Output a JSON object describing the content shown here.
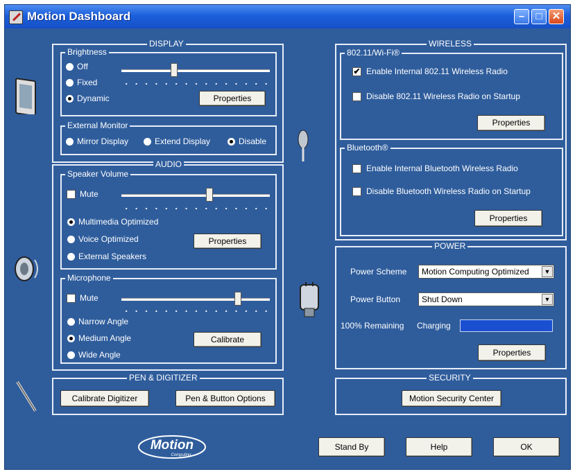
{
  "window": {
    "title": "Motion Dashboard",
    "minimize": "–",
    "maximize": "□",
    "close": "✕"
  },
  "icons": [
    "tablet-icon",
    "speaker-icon",
    "pen-icon",
    "antenna-icon",
    "power-plug-icon",
    "motion-logo"
  ],
  "brand": {
    "logo_text": "Motion",
    "logo_sub": "Computing"
  },
  "display": {
    "title": "DISPLAY",
    "brightness": {
      "title": "Brightness",
      "options": [
        "Off",
        "Fixed",
        "Dynamic"
      ],
      "selected": "Dynamic",
      "level": 0.35,
      "properties": "Properties"
    },
    "external_monitor": {
      "title": "External Monitor",
      "options": [
        "Mirror Display",
        "Extend Display",
        "Disable"
      ],
      "selected": "Disable"
    }
  },
  "audio": {
    "title": "AUDIO",
    "speaker": {
      "title": "Speaker Volume",
      "mute_label": "Mute",
      "muted": false,
      "level": 0.6,
      "options": [
        "Multimedia Optimized",
        "Voice Optimized",
        "External Speakers"
      ],
      "selected": "Multimedia Optimized",
      "properties": "Properties"
    },
    "microphone": {
      "title": "Microphone",
      "mute_label": "Mute",
      "muted": false,
      "level": 0.8,
      "options": [
        "Narrow Angle",
        "Medium Angle",
        "Wide Angle"
      ],
      "selected": "Medium Angle",
      "calibrate": "Calibrate"
    }
  },
  "pen": {
    "title": "PEN & DIGITIZER",
    "calibrate": "Calibrate Digitizer",
    "options": "Pen & Button Options"
  },
  "wireless": {
    "title": "WIRELESS",
    "wifi": {
      "title": "802.11/Wi-Fi®",
      "enable_label": "Enable Internal 802.11 Wireless Radio",
      "enable": true,
      "disable_label": "Disable 802.11 Wireless Radio on Startup",
      "disable": false,
      "properties": "Properties"
    },
    "bluetooth": {
      "title": "Bluetooth®",
      "enable_label": "Enable Internal Bluetooth Wireless Radio",
      "enable": false,
      "disable_label": "Disable Bluetooth Wireless Radio on Startup",
      "disable": false,
      "properties": "Properties"
    }
  },
  "power": {
    "title": "POWER",
    "scheme_label": "Power Scheme",
    "scheme_value": "Motion Computing Optimized",
    "button_label": "Power Button",
    "button_value": "Shut Down",
    "remaining": "100% Remaining",
    "status": "Charging",
    "battery_level": 1.0,
    "properties": "Properties"
  },
  "security": {
    "title": "SECURITY",
    "center": "Motion Security Center"
  },
  "footer": {
    "standby": "Stand By",
    "help": "Help",
    "ok": "OK"
  }
}
